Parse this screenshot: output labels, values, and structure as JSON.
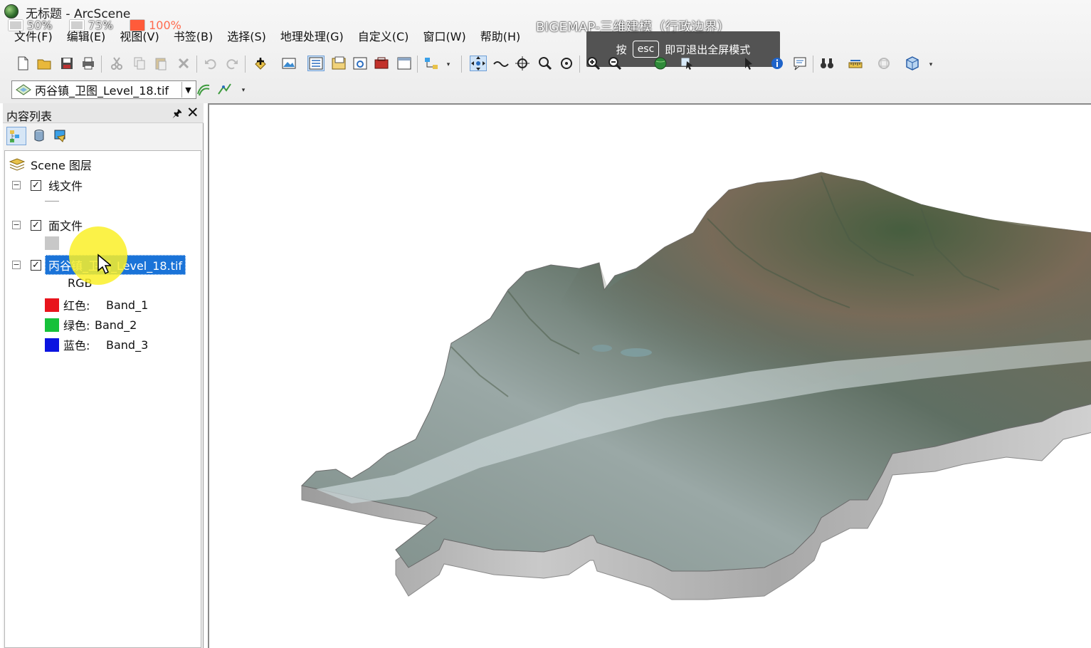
{
  "window": {
    "title": "无标题 - ArcScene"
  },
  "zoom_overlay": {
    "options": [
      "50%",
      "75%",
      "100%"
    ],
    "active": "100%"
  },
  "video_title": "BIGEMAP-三维建模（行政边界）",
  "menubar": {
    "items": [
      "文件(F)",
      "编辑(E)",
      "视图(V)",
      "书签(B)",
      "选择(S)",
      "地理处理(G)",
      "自定义(C)",
      "窗口(W)",
      "帮助(H)"
    ]
  },
  "esc_toast": {
    "prefix": "按",
    "key": "esc",
    "suffix": "即可退出全屏模式"
  },
  "layer_combo": {
    "value": "丙谷镇_卫图_Level_18.tif"
  },
  "toc": {
    "title": "内容列表",
    "pin_glyph": "🖈",
    "close_glyph": "✕",
    "root_label": "Scene 图层",
    "layers": [
      {
        "name": "线文件",
        "checked": true
      },
      {
        "name": "面文件",
        "checked": true
      },
      {
        "name": "丙谷镇_卫图_Level_18.tif",
        "checked": true,
        "selected": true
      }
    ],
    "raster": {
      "render_label": "RGB",
      "bands": [
        {
          "channel": "红色:",
          "band": "Band_1",
          "color": "#e8141c"
        },
        {
          "channel": "绿色:",
          "band": "Band_2",
          "color": "#16c13a"
        },
        {
          "channel": "蓝色:",
          "band": "Band_3",
          "color": "#0b14e0"
        }
      ]
    },
    "polygon_swatch_color": "#c8c8c8",
    "line_swatch_color": "#9a9a9a"
  },
  "colors": {
    "selection": "#1a73d8",
    "cursor_highlight": "#faf028",
    "terrain_side": "#b8b8b8",
    "terrain_top": "#6f8488"
  }
}
